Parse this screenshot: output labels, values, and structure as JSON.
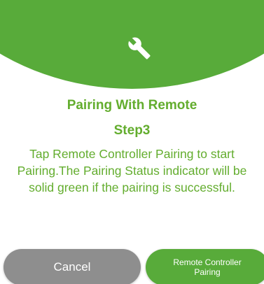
{
  "header": {
    "icon": "wrench-icon",
    "color": "#58ab3a"
  },
  "dialog": {
    "title": "Pairing With Remote",
    "step": "Step3",
    "instructions": {
      "line1": "Tap Remote Controller Pairing to start",
      "line2": "Pairing.The Pairing Status indicator will be",
      "line3": "solid green if the pairing is successful."
    },
    "text_color": "#63ad2e"
  },
  "buttons": {
    "cancel_label": "Cancel",
    "pair_label_line1": "Remote Controller",
    "pair_label_line2": "Pairing",
    "cancel_color": "#8e8e8e",
    "pair_color": "#58ab3a"
  }
}
